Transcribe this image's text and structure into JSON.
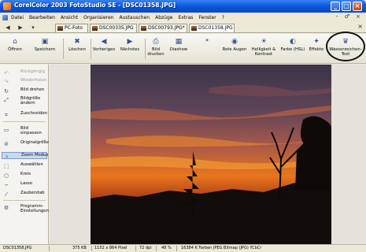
{
  "window": {
    "title": "CorelColor 2003 FotoStudio SE - [DSC01358.JPG]"
  },
  "menubar": {
    "items": [
      "Datei",
      "Bearbeiten",
      "Ansicht",
      "Organisieren",
      "Austauschen",
      "Abzüge",
      "Extras",
      "Fenster",
      "?"
    ],
    "right_controls": "- ♂ ×"
  },
  "tabs": {
    "items": [
      {
        "label": "PC-Foto"
      },
      {
        "label": "DSC00335.JPG"
      },
      {
        "label": "DSC00793.JPG*"
      },
      {
        "label": "DSC01358.JPG"
      }
    ],
    "active_index": 3,
    "close_label": "×"
  },
  "toolbar": {
    "buttons": [
      {
        "label": "Öffnen",
        "icon": "folder-open-icon"
      },
      {
        "label": "Speichern",
        "icon": "save-icon"
      },
      {
        "label": "Löschen",
        "icon": "trash-icon"
      },
      {
        "label": "Vorheriges",
        "icon": "arrow-left-icon"
      },
      {
        "label": "Nächstes",
        "icon": "arrow-right-icon"
      },
      {
        "label": "Bild drucken",
        "icon": "printer-icon"
      },
      {
        "label": "Diashow",
        "icon": "slideshow-icon"
      },
      {
        "label": "Rote Augen",
        "icon": "red-eye-icon"
      },
      {
        "label": "Helligkeit & Kontrast",
        "icon": "brightness-icon"
      },
      {
        "label": "Farbe (HSL)",
        "icon": "color-icon"
      },
      {
        "label": "Effekte",
        "icon": "effects-icon"
      },
      {
        "label": "Wasserzeichen-Text",
        "icon": "watermark-icon"
      }
    ],
    "overflow_label": "»"
  },
  "left_panel": {
    "items": [
      {
        "label": "Rückgängig",
        "icon": "undo-icon",
        "disabled": true
      },
      {
        "label": "Wiederholen",
        "icon": "redo-icon",
        "disabled": true
      },
      {
        "label": "Bild drehen",
        "icon": "rotate-icon",
        "disabled": false
      },
      {
        "label": "Bildgröße ändern",
        "icon": "resize-icon",
        "disabled": false
      },
      {
        "label": "Zuschneiden",
        "icon": "crop-icon",
        "disabled": false
      },
      {
        "label": "Bild einpassen",
        "icon": "fit-icon",
        "disabled": false
      },
      {
        "label": "Originalgröße",
        "icon": "original-size-icon",
        "disabled": false
      },
      {
        "label": "Zoom Modus",
        "icon": "zoom-icon",
        "disabled": false,
        "selected": true
      },
      {
        "label": "Auswählen",
        "icon": "select-icon",
        "disabled": false
      },
      {
        "label": "Kreis",
        "icon": "circle-icon",
        "disabled": false
      },
      {
        "label": "Lasso",
        "icon": "lasso-icon",
        "disabled": false
      },
      {
        "label": "Zauberstab",
        "icon": "magic-wand-icon",
        "disabled": false
      },
      {
        "label": "Programm-Einstellungen",
        "icon": "settings-icon",
        "disabled": false
      }
    ]
  },
  "statusbar": {
    "filename": "DSC01358.JPG",
    "filesize": "375 KB",
    "dimensions": "1152 x 864 Pixel",
    "dpi": "72 dpi",
    "zoom": "48 %",
    "colors": "16384 K Farben JPEG Bitmap (JPG) YCbCr"
  },
  "colors": {
    "titlebar": "#0a56de",
    "sky_top": "#3b3448",
    "sky_glow": "#e8761c",
    "silhouette": "#0e0a08"
  }
}
